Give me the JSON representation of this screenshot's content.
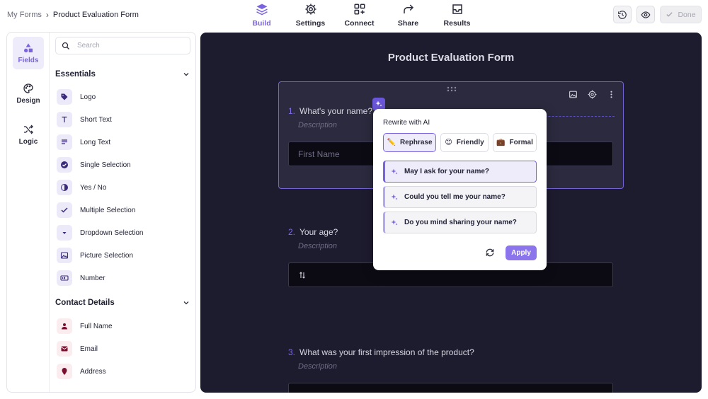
{
  "breadcrumb": {
    "parent": "My Forms",
    "separator": "›",
    "current": "Product Evaluation Form"
  },
  "nav": [
    {
      "label": "Build",
      "icon": "layers-icon",
      "active": true
    },
    {
      "label": "Settings",
      "icon": "gear-icon",
      "active": false
    },
    {
      "label": "Connect",
      "icon": "connect-icon",
      "active": false
    },
    {
      "label": "Share",
      "icon": "share-icon",
      "active": false
    },
    {
      "label": "Results",
      "icon": "inbox-icon",
      "active": false
    }
  ],
  "actions": {
    "done_label": "Done"
  },
  "rail": [
    {
      "label": "Fields",
      "icon": "shapes-icon",
      "active": true
    },
    {
      "label": "Design",
      "icon": "palette-icon",
      "active": false
    },
    {
      "label": "Logic",
      "icon": "shuffle-icon",
      "active": false
    }
  ],
  "search": {
    "placeholder": "Search",
    "value": ""
  },
  "essentials": {
    "title": "Essentials",
    "items": [
      "Logo",
      "Short Text",
      "Long Text",
      "Single Selection",
      "Yes / No",
      "Multiple Selection",
      "Dropdown Selection",
      "Picture Selection",
      "Number"
    ]
  },
  "contact": {
    "title": "Contact Details",
    "items": [
      "Full Name",
      "Email",
      "Address"
    ]
  },
  "form": {
    "title": "Product Evaluation Form",
    "questions": [
      {
        "number": "1.",
        "label": "What's your name?",
        "description": "Description",
        "placeholder": "First Name"
      },
      {
        "number": "2.",
        "label": "Your age?",
        "description": "Description",
        "placeholder": ""
      },
      {
        "number": "3.",
        "label": "What was your first impression of the product?",
        "description": "Description",
        "placeholder": ""
      }
    ]
  },
  "ai_popover": {
    "title": "Rewrite with AI",
    "tones": [
      {
        "label": "Rephrase",
        "emoji": "✏️",
        "active": true
      },
      {
        "label": "Friendly",
        "emoji": "😊",
        "active": false
      },
      {
        "label": "Formal",
        "emoji": "💼",
        "active": false
      }
    ],
    "suggestions": [
      "May I ask for your name?",
      "Could you tell me your name?",
      "Do you mind sharing your name?"
    ],
    "apply_label": "Apply"
  },
  "colors": {
    "accent": "#7b63e0",
    "canvas_bg": "#1d1b2e",
    "card_bg": "#2b2a3e"
  }
}
